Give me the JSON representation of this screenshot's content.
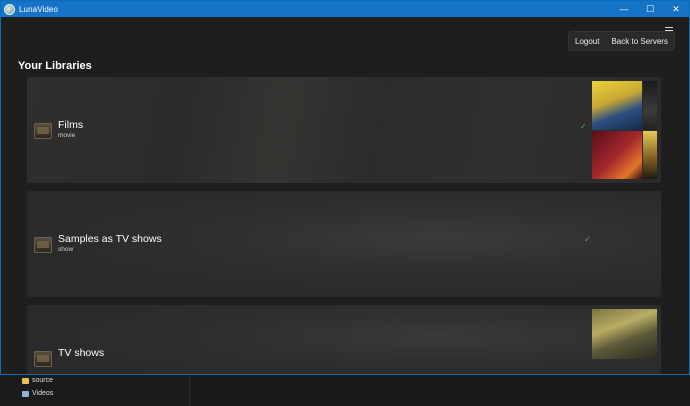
{
  "window": {
    "title": "LunaVideo",
    "controls": {
      "minimize": "—",
      "maximize": "☐",
      "close": "✕"
    }
  },
  "header": {
    "logout_label": "Logout",
    "back_label": "Back to Servers"
  },
  "main": {
    "section_title": "Your Libraries",
    "libraries": [
      {
        "name": "Films",
        "type": "movie"
      },
      {
        "name": "Samples as TV shows",
        "type": "show"
      },
      {
        "name": "TV shows",
        "type": ""
      }
    ]
  },
  "explorer": {
    "items": [
      "source",
      "Videos"
    ]
  },
  "colors": {
    "titlebar": "#1673c8",
    "background": "#1e1e1e",
    "card": "#2b2b2b"
  }
}
